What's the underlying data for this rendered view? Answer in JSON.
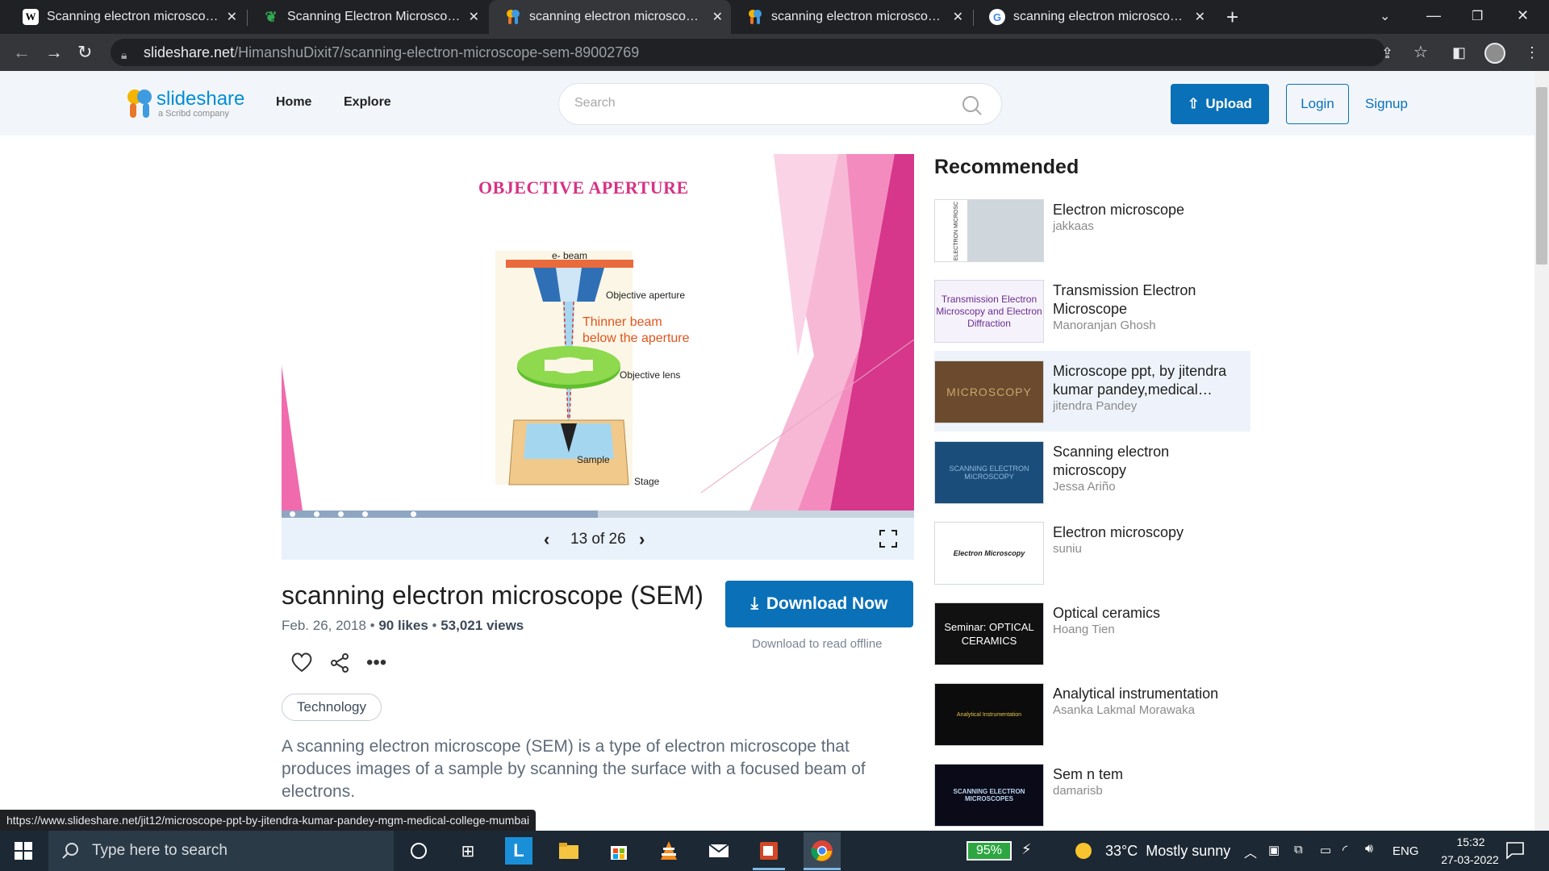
{
  "browser": {
    "tabs": [
      {
        "title": "Scanning electron microscope - V",
        "favicon": "W",
        "active": false
      },
      {
        "title": "Scanning Electron Microscopy (SE",
        "favicon": "leaf",
        "active": false
      },
      {
        "title": "scanning electron microscope (SE",
        "favicon": "slideshare",
        "active": true
      },
      {
        "title": "scanning electron microscope (SE",
        "favicon": "slideshare",
        "active": false
      },
      {
        "title": "scanning electron microscope - G",
        "favicon": "G",
        "active": false
      }
    ],
    "url_domain": "slideshare.net",
    "url_path": "/HimanshuDixit7/scanning-electron-microscope-sem-89002769",
    "status_url": "https://www.slideshare.net/jit12/microscope-ppt-by-jitendra-kumar-pandey-mgm-medical-college-mumbai"
  },
  "header": {
    "logo_text": "slideshare",
    "logo_sub": "a Scribd company",
    "nav": [
      "Home",
      "Explore"
    ],
    "search_placeholder": "Search",
    "upload_label": "Upload",
    "login_label": "Login",
    "signup_label": "Signup"
  },
  "slide": {
    "title": "OBJECTIVE APERTURE",
    "labels": {
      "ebeam": "e- beam",
      "aperture": "Objective aperture",
      "thinner1": "Thinner beam",
      "thinner2": "below the aperture",
      "lens": "Objective lens",
      "sample": "Sample",
      "stage": "Stage"
    },
    "pager": "13 of 26",
    "progress": 0.5
  },
  "doc": {
    "title": "scanning electron microscope (SEM)",
    "date": "Feb. 26, 2018",
    "likes": "90 likes",
    "views": "53,021 views",
    "download_label": "Download Now",
    "download_sub": "Download to read offline",
    "tag": "Technology",
    "description": "A scanning electron microscope (SEM) is a type of electron microscope that produces images of a sample by scanning the surface with a focused beam of electrons."
  },
  "recommended": {
    "heading": "Recommended",
    "items": [
      {
        "title": "Electron microscope",
        "author": "jakkaas",
        "thumb_text": "ELECTRON MICROSC"
      },
      {
        "title": "Transmission Electron Microscope",
        "author": "Manoranjan Ghosh",
        "thumb_text": "Transmission Electron Microscopy and Electron Diffraction"
      },
      {
        "title": "Microscope ppt, by jitendra kumar pandey,medical…",
        "author": "jitendra Pandey",
        "thumb_text": "MICROSCOPY"
      },
      {
        "title": "Scanning electron microscopy",
        "author": "Jessa Ariño",
        "thumb_text": "SCANNING ELECTRON MICROSCOPY"
      },
      {
        "title": "Electron microscopy",
        "author": "suniu",
        "thumb_text": "Electron Microscopy"
      },
      {
        "title": "Optical ceramics",
        "author": "Hoang Tien",
        "thumb_text": "Seminar: OPTICAL CERAMICS"
      },
      {
        "title": "Analytical instrumentation",
        "author": "Asanka Lakmal Morawaka",
        "thumb_text": "Analytical Instrumentation"
      },
      {
        "title": "Sem n tem",
        "author": "damarisb",
        "thumb_text": "SCANNING ELECTRON MICROSCOPES"
      }
    ]
  },
  "taskbar": {
    "search_placeholder": "Type here to search",
    "battery": "95%",
    "weather": "33°C  Mostly sunny",
    "lang": "ENG",
    "time": "15:32",
    "date": "27-03-2022"
  },
  "colors": {
    "brand": "#0a71b8",
    "slide_pink": "#d63384"
  }
}
